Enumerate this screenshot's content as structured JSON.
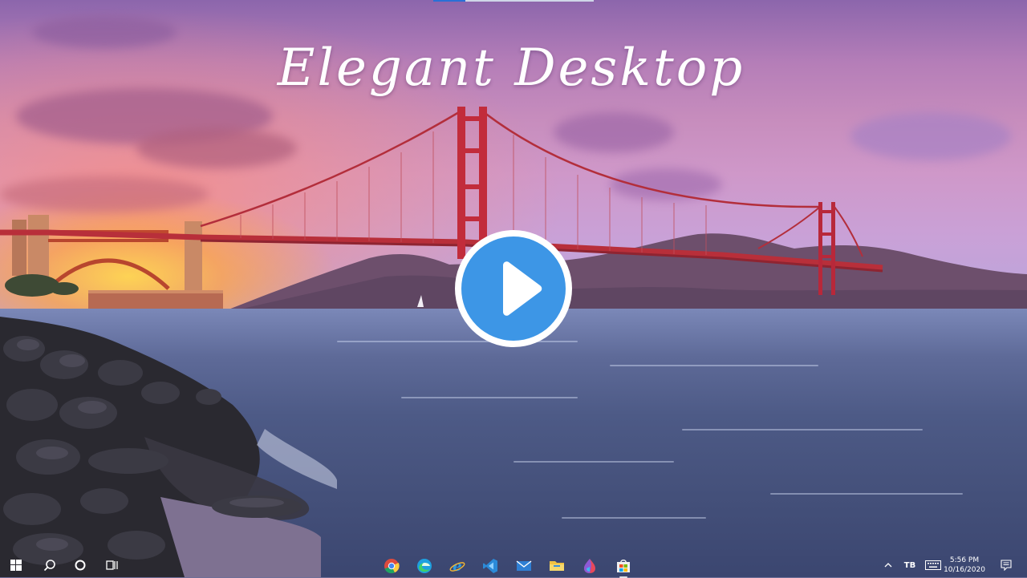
{
  "wallpaper": {
    "title": "Elegant Desktop"
  },
  "video": {
    "progress": 0.2,
    "play_icon": "play-icon"
  },
  "taskbar": {
    "left": [
      {
        "name": "start-button",
        "icon": "windows-icon"
      },
      {
        "name": "search-button",
        "icon": "search-icon"
      },
      {
        "name": "cortana-button",
        "icon": "circle-icon"
      },
      {
        "name": "task-view-button",
        "icon": "task-view-icon"
      }
    ],
    "apps": [
      {
        "name": "taskbar-app-chrome",
        "icon": "chrome-icon",
        "color": "#dd4b3e"
      },
      {
        "name": "taskbar-app-edge",
        "icon": "edge-icon",
        "color": "#1fa0e0"
      },
      {
        "name": "taskbar-app-internet-explorer",
        "icon": "internet-explorer-icon",
        "color": "#2a9be4"
      },
      {
        "name": "taskbar-app-visual-studio-code",
        "icon": "vscode-icon",
        "color": "#2b8ad8"
      },
      {
        "name": "taskbar-app-mail",
        "icon": "mail-icon",
        "color": "#2f7fd4"
      },
      {
        "name": "taskbar-app-file-explorer",
        "icon": "folder-icon",
        "color": "#f1c243"
      },
      {
        "name": "taskbar-app-paint-3d",
        "icon": "paint-icon",
        "color": "#e8495b"
      },
      {
        "name": "taskbar-app-store",
        "icon": "store-icon",
        "color": "#f0f0f0"
      }
    ],
    "tray": {
      "chevron_icon": "chevron-up-icon",
      "app_badge": "TB",
      "keyboard_icon": "keyboard-icon",
      "notification_icon": "notification-icon"
    },
    "clock": {
      "time": "5:56 PM",
      "date": "10/16/2020"
    }
  }
}
